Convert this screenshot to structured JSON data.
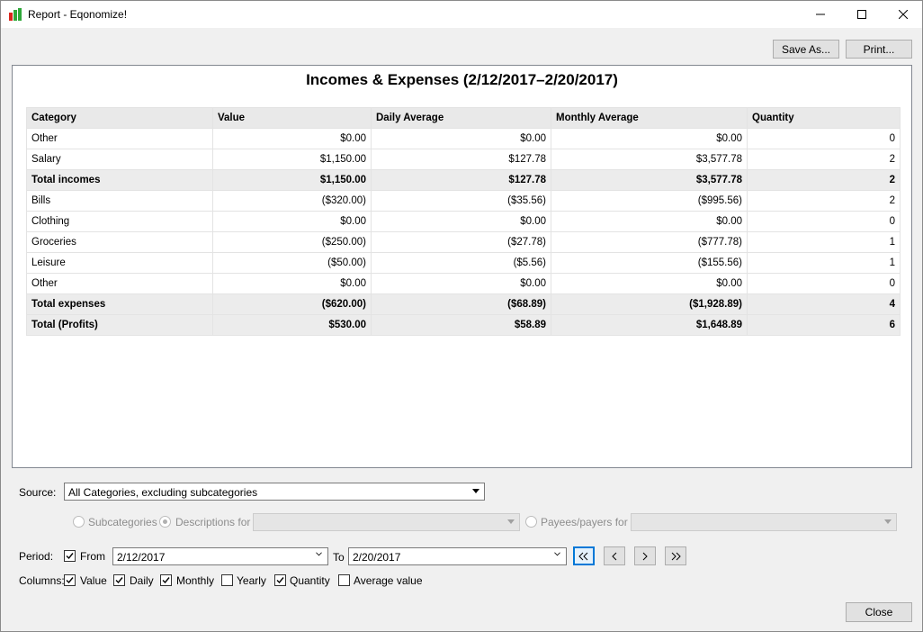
{
  "window": {
    "title": "Report - Eqonomize!"
  },
  "toolbar": {
    "save_as": "Save As...",
    "print": "Print..."
  },
  "report": {
    "title": "Incomes & Expenses (2/12/2017–2/20/2017)",
    "columns": [
      "Category",
      "Value",
      "Daily Average",
      "Monthly Average",
      "Quantity"
    ],
    "rows": [
      {
        "category": "Other",
        "value": "$0.00",
        "daily": "$0.00",
        "monthly": "$0.00",
        "quantity": "0",
        "total": false
      },
      {
        "category": "Salary",
        "value": "$1,150.00",
        "daily": "$127.78",
        "monthly": "$3,577.78",
        "quantity": "2",
        "total": false
      },
      {
        "category": "Total incomes",
        "value": "$1,150.00",
        "daily": "$127.78",
        "monthly": "$3,577.78",
        "quantity": "2",
        "total": true
      },
      {
        "category": "Bills",
        "value": "($320.00)",
        "daily": "($35.56)",
        "monthly": "($995.56)",
        "quantity": "2",
        "total": false
      },
      {
        "category": "Clothing",
        "value": "$0.00",
        "daily": "$0.00",
        "monthly": "$0.00",
        "quantity": "0",
        "total": false
      },
      {
        "category": "Groceries",
        "value": "($250.00)",
        "daily": "($27.78)",
        "monthly": "($777.78)",
        "quantity": "1",
        "total": false
      },
      {
        "category": "Leisure",
        "value": "($50.00)",
        "daily": "($5.56)",
        "monthly": "($155.56)",
        "quantity": "1",
        "total": false
      },
      {
        "category": "Other",
        "value": "$0.00",
        "daily": "$0.00",
        "monthly": "$0.00",
        "quantity": "0",
        "total": false
      },
      {
        "category": "Total expenses",
        "value": "($620.00)",
        "daily": "($68.89)",
        "monthly": "($1,928.89)",
        "quantity": "4",
        "total": true
      },
      {
        "category": "Total (Profits)",
        "value": "$530.00",
        "daily": "$58.89",
        "monthly": "$1,648.89",
        "quantity": "6",
        "total": true
      }
    ]
  },
  "source": {
    "label": "Source:",
    "selected": "All Categories, excluding subcategories",
    "subcategories_label": "Subcategories",
    "descriptions_label": "Descriptions for",
    "payees_label": "Payees/payers for"
  },
  "period": {
    "label": "Period:",
    "from_label": "From",
    "from_value": "2/12/2017",
    "to_label": "To",
    "to_value": "2/20/2017"
  },
  "columns_opts": {
    "label": "Columns:",
    "value": "Value",
    "daily": "Daily",
    "monthly": "Monthly",
    "yearly": "Yearly",
    "quantity": "Quantity",
    "average": "Average value"
  },
  "footer": {
    "close": "Close"
  },
  "colors": {
    "accent": "#0078d7",
    "header_bg": "#e9e9e9",
    "total_bg": "#ececec"
  }
}
